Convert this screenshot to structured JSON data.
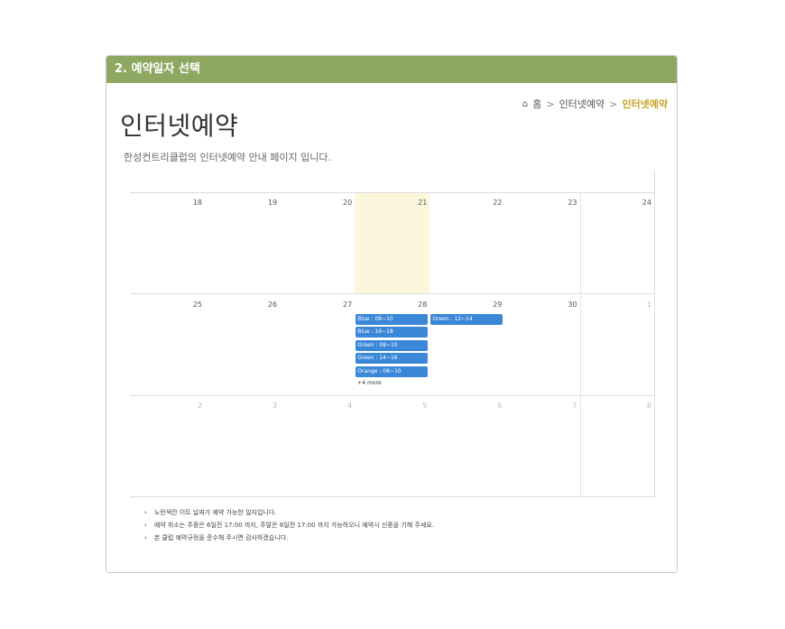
{
  "panel": {
    "header": "2. 예약일자 선택"
  },
  "breadcrumb": {
    "home": "홈",
    "item1": "인터넷예약",
    "current": "인터넷예약"
  },
  "page": {
    "title": "인터넷예약",
    "subtitle": "한성컨트리클럽의 인터넷예약 안내 페이지 입니다."
  },
  "calendar": {
    "weeks": [
      {
        "days": [
          {
            "num": "18"
          },
          {
            "num": "19"
          },
          {
            "num": "20"
          },
          {
            "num": "21",
            "today": true
          },
          {
            "num": "22"
          },
          {
            "num": "23"
          },
          {
            "num": "24"
          }
        ]
      },
      {
        "days": [
          {
            "num": "25"
          },
          {
            "num": "26"
          },
          {
            "num": "27"
          },
          {
            "num": "28",
            "events": [
              "Blue : 08~10",
              "Blue : 16~18",
              "Green : 08~10",
              "Green : 14~16",
              "Orange : 08~10"
            ],
            "more": "+4 more"
          },
          {
            "num": "29",
            "events": [
              "Green : 12~14"
            ]
          },
          {
            "num": "30"
          },
          {
            "num": "1",
            "other": true
          }
        ]
      },
      {
        "days": [
          {
            "num": "2",
            "other": true
          },
          {
            "num": "3",
            "other": true
          },
          {
            "num": "4",
            "other": true
          },
          {
            "num": "5",
            "other": true
          },
          {
            "num": "6",
            "other": true
          },
          {
            "num": "7",
            "other": true
          },
          {
            "num": "8",
            "other": true
          }
        ]
      }
    ]
  },
  "notes": [
    "노란색칸 이트 날짜가 예약 가능한 일자입니다.",
    "예약 취소는 주중은 6일전 17:00 까지, 주말은 6일전 17:00 까지 가능하오니 예약시 신중을 기해 주세요.",
    "본 클럽 예약규정을 준수해 주시면 감사하겠습니다."
  ]
}
